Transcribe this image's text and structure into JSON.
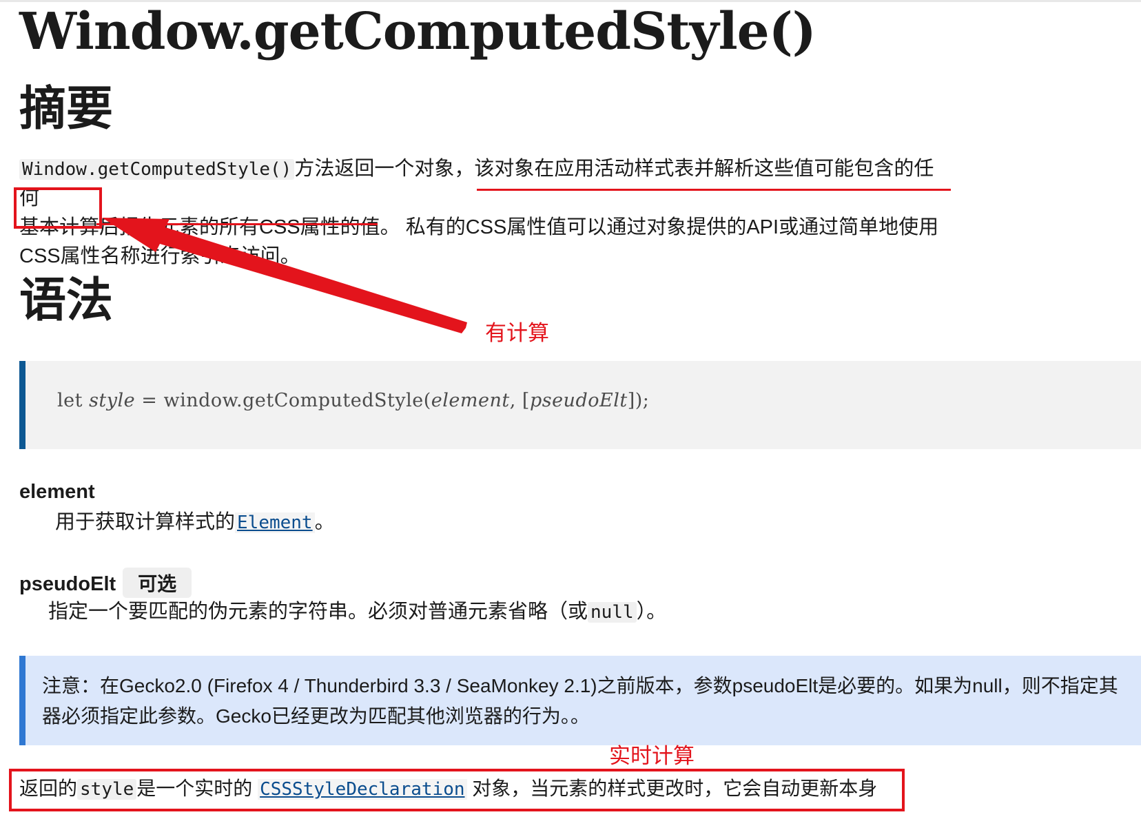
{
  "title": "Window.getComputedStyle()",
  "sections": {
    "summary_heading": "摘要",
    "syntax_heading": "语法"
  },
  "summary": {
    "code": "Window.getComputedStyle()",
    "text_1": "方法返回一个对象，",
    "text_underlined": "该对象在应用活动样式表并解析这些值可能包含的任何",
    "text_line2_boxed": "基本计算",
    "text_line2_underlined": "后报告元素的所有CSS属性的值",
    "text_line2_rest": "。 私有的CSS属性值可以通过对象提供的API或通过简单地使用",
    "text_line3": "CSS属性名称进行索引来访问。"
  },
  "syntax": {
    "kw": "let",
    "var": "style",
    "eq": "=",
    "call": "window.getComputedStyle(",
    "arg1": "element",
    "sep": ",",
    "open_opt": "[",
    "arg2": "pseudoElt",
    "close": "]);"
  },
  "params": {
    "element": {
      "term": "element",
      "desc_prefix": "用于获取计算样式的",
      "desc_link": "Element",
      "desc_suffix": "。"
    },
    "pseudo": {
      "term": "pseudoElt",
      "badge": "可选",
      "desc_prefix": "指定一个要匹配的伪元素的字符串。必须对普通元素省略（或",
      "desc_code": "null",
      "desc_suffix": "）。"
    }
  },
  "note": {
    "line1": "注意：在Gecko2.0 (Firefox 4 / Thunderbird 3.3 / SeaMonkey 2.1)之前版本，参数pseudoElt是必要的。如果为null，则不指定其",
    "line2": "器必须指定此参数。Gecko已经更改为匹配其他浏览器的行为。。"
  },
  "return_value": {
    "prefix": "返回的",
    "code": "style",
    "mid": "是一个实时的",
    "link": "CSSStyleDeclaration",
    "suffix": "对象，当元素的样式更改时，它会自动更新本身"
  },
  "annotations": {
    "label_1": "有计算",
    "label_2": "实时计算",
    "color": "#e3141c"
  }
}
